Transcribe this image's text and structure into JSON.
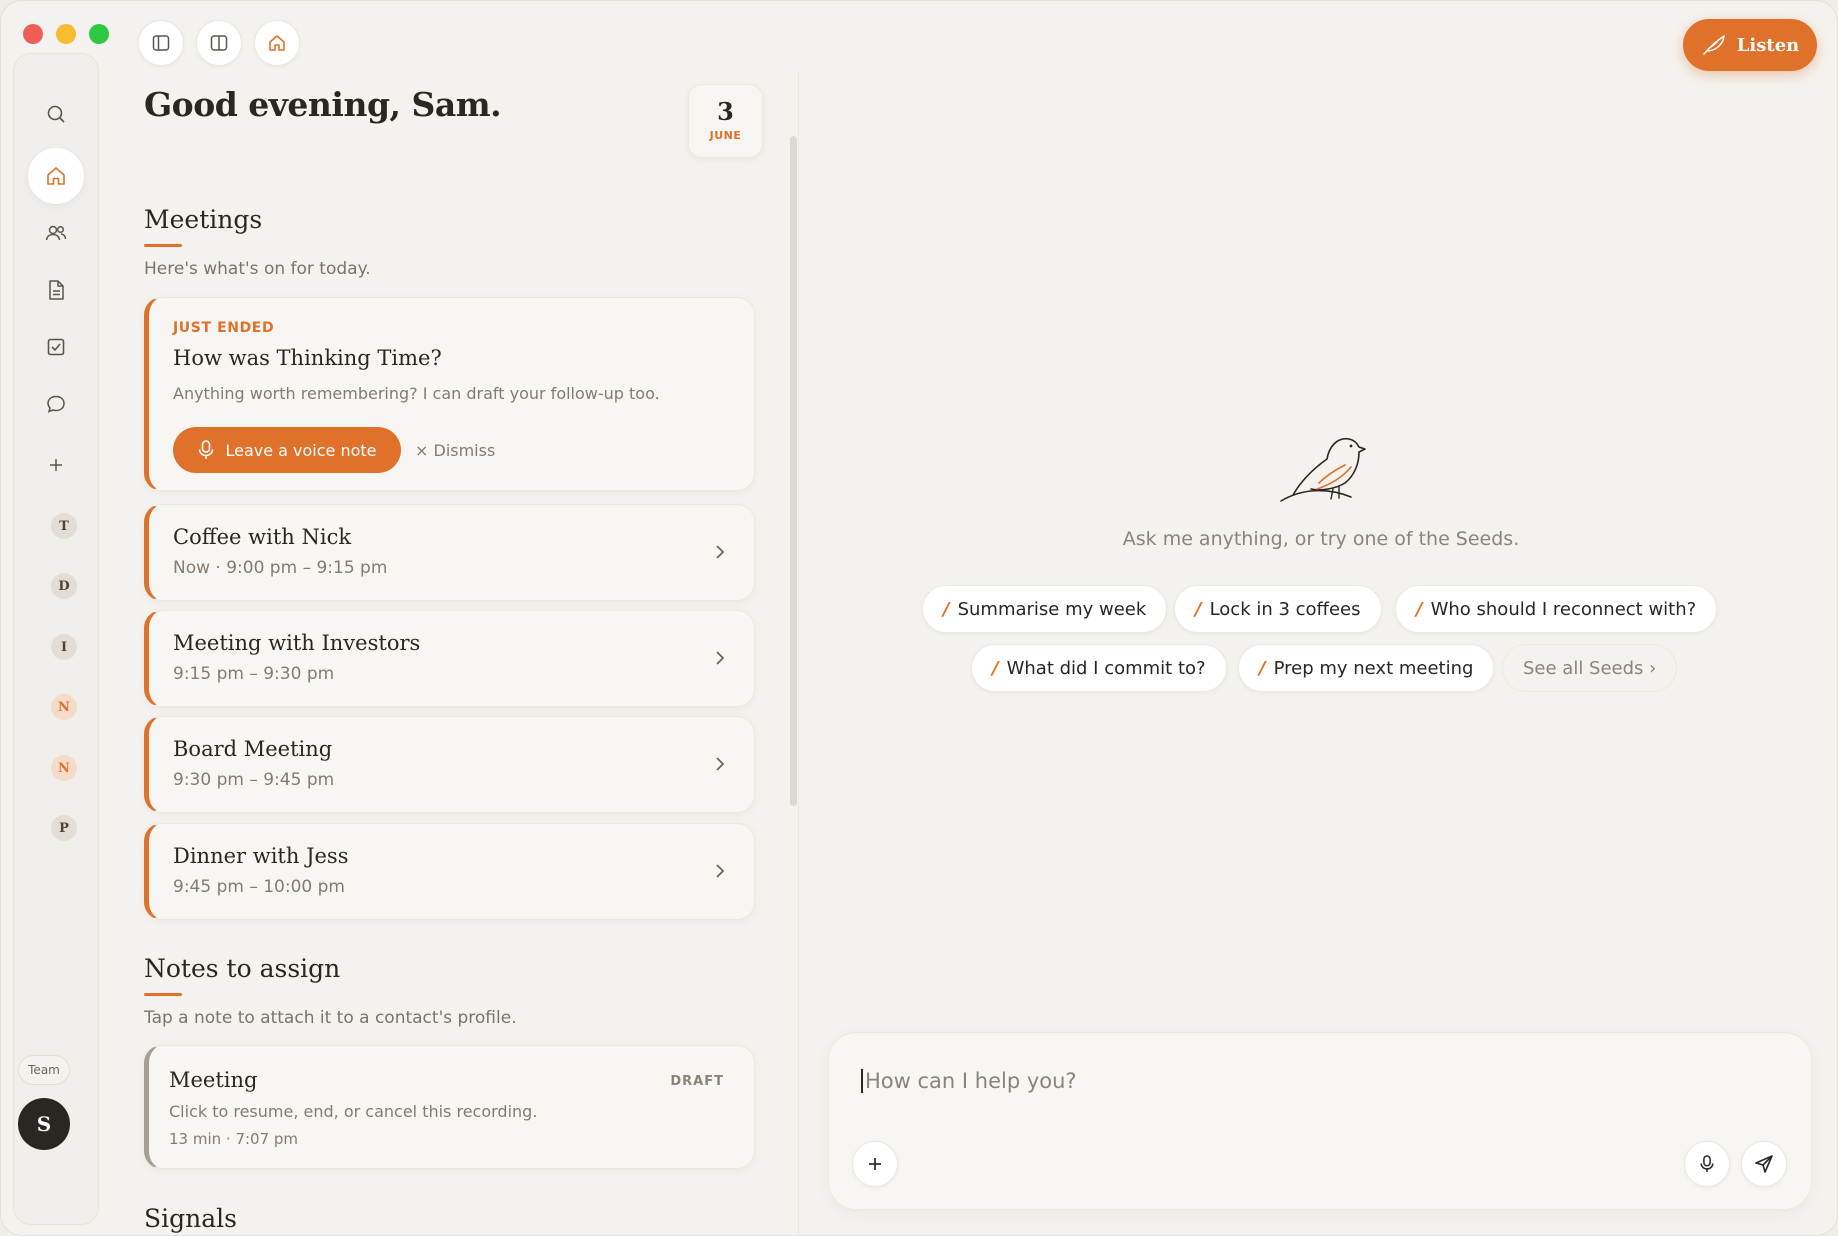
{
  "window": {
    "controls": [
      "close",
      "minimize",
      "zoom"
    ]
  },
  "toolbar": {
    "buttons": [
      "sidebar-toggle-icon",
      "split-view-icon",
      "home-icon"
    ],
    "listen_label": "Listen"
  },
  "rail": {
    "nav": [
      "search-icon",
      "home-icon",
      "people-icon",
      "document-icon",
      "checkbox-icon",
      "chat-icon",
      "plus-icon"
    ],
    "contacts": [
      "T",
      "D",
      "I",
      "N",
      "N",
      "P"
    ],
    "team_label": "Team",
    "avatar_initial": "S"
  },
  "greeting": "Good evening, Sam.",
  "date": {
    "day": "3",
    "month": "JUNE"
  },
  "meetings": {
    "title": "Meetings",
    "subtitle": "Here's what's on for today.",
    "just_ended": {
      "label": "JUST ENDED",
      "title": "How was Thinking Time?",
      "subtitle": "Anything worth remembering? I can draft your follow-up too.",
      "voice_button": "Leave a voice note",
      "dismiss": "× Dismiss"
    },
    "items": [
      {
        "title": "Coffee with Nick",
        "time": "Now · 9:00 pm – 9:15 pm"
      },
      {
        "title": "Meeting with Investors",
        "time": "9:15 pm – 9:30 pm"
      },
      {
        "title": "Board Meeting",
        "time": "9:30 pm – 9:45 pm"
      },
      {
        "title": "Dinner with Jess",
        "time": "9:45 pm – 10:00 pm"
      }
    ]
  },
  "notes": {
    "title": "Notes to assign",
    "subtitle": "Tap a note to attach it to a contact's profile.",
    "item": {
      "title": "Meeting",
      "badge": "DRAFT",
      "subtitle": "Click to resume, end, or cancel this recording.",
      "meta": "13 min · 7:07 pm"
    }
  },
  "signals": {
    "title": "Signals"
  },
  "assistant": {
    "prompt": "Ask me anything, or try one of the Seeds.",
    "seeds": [
      "Summarise my week",
      "Lock in 3 coffees",
      "Who should I reconnect with?",
      "What did I commit to?",
      "Prep my next meeting"
    ],
    "see_all": "See all Seeds ›",
    "input_placeholder": "How can I help you?"
  },
  "colors": {
    "accent": "#e0712a",
    "background": "#f4f2ee",
    "text": "#2a2622"
  }
}
